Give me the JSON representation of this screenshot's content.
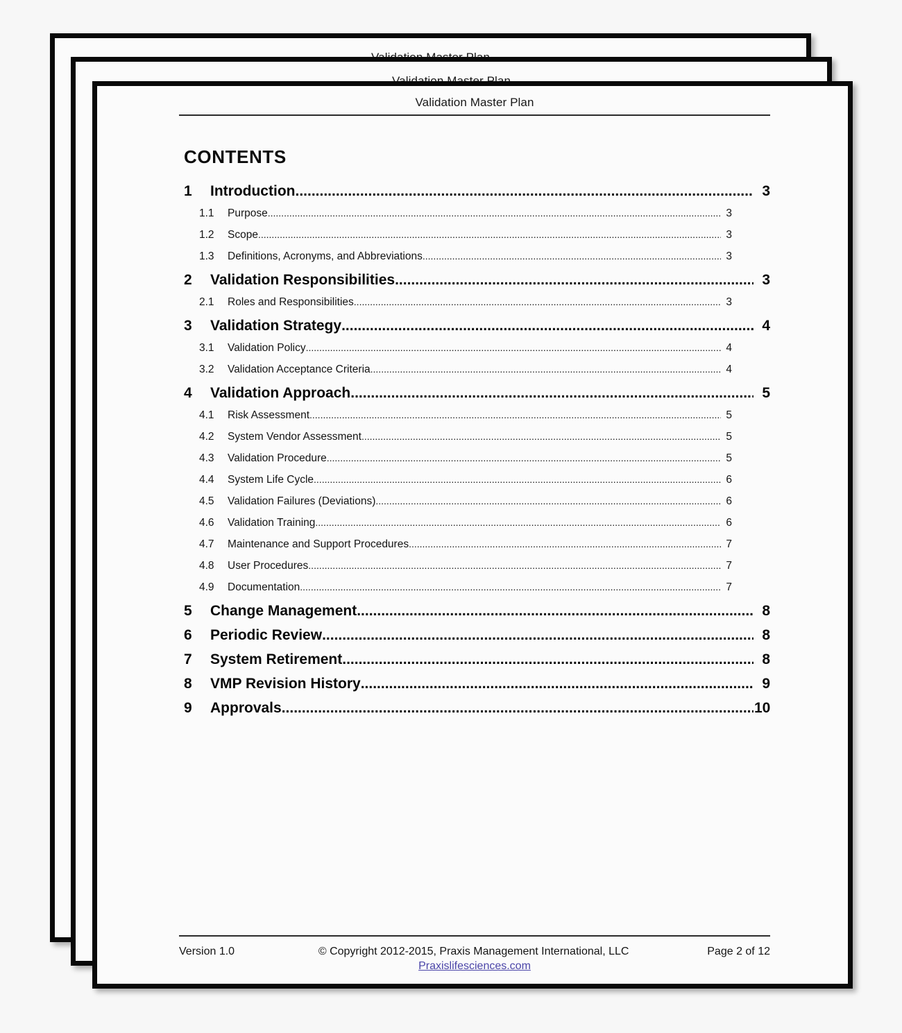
{
  "document": {
    "header_title": "Validation Master Plan",
    "contents_heading": "CONTENTS"
  },
  "stack": {
    "back_sheet_1_header": "Validation Master Plan",
    "back_sheet_2_header": "Validation Master Plan"
  },
  "toc": {
    "entries": [
      {
        "level": 1,
        "number": "1",
        "label": "Introduction",
        "page": "3"
      },
      {
        "level": 2,
        "number": "1.1",
        "label": "Purpose",
        "page": "3"
      },
      {
        "level": 2,
        "number": "1.2",
        "label": "Scope",
        "page": "3"
      },
      {
        "level": 2,
        "number": "1.3",
        "label": "Definitions, Acronyms, and Abbreviations",
        "page": "3"
      },
      {
        "level": 1,
        "number": "2",
        "label": "Validation Responsibilities",
        "page": "3"
      },
      {
        "level": 2,
        "number": "2.1",
        "label": "Roles and Responsibilities",
        "page": "3"
      },
      {
        "level": 1,
        "number": "3",
        "label": "Validation Strategy",
        "page": "4"
      },
      {
        "level": 2,
        "number": "3.1",
        "label": "Validation Policy",
        "page": "4"
      },
      {
        "level": 2,
        "number": "3.2",
        "label": "Validation Acceptance Criteria",
        "page": "4"
      },
      {
        "level": 1,
        "number": "4",
        "label": "Validation Approach",
        "page": "5"
      },
      {
        "level": 2,
        "number": "4.1",
        "label": "Risk Assessment",
        "page": "5"
      },
      {
        "level": 2,
        "number": "4.2",
        "label": "System Vendor Assessment",
        "page": "5"
      },
      {
        "level": 2,
        "number": "4.3",
        "label": "Validation Procedure",
        "page": "5"
      },
      {
        "level": 2,
        "number": "4.4",
        "label": "System Life Cycle",
        "page": "6"
      },
      {
        "level": 2,
        "number": "4.5",
        "label": "Validation Failures (Deviations)",
        "page": "6"
      },
      {
        "level": 2,
        "number": "4.6",
        "label": "Validation Training",
        "page": "6"
      },
      {
        "level": 2,
        "number": "4.7",
        "label": "Maintenance and Support Procedures",
        "page": "7"
      },
      {
        "level": 2,
        "number": "4.8",
        "label": "User Procedures",
        "page": "7"
      },
      {
        "level": 2,
        "number": "4.9",
        "label": "Documentation",
        "page": "7"
      },
      {
        "level": 1,
        "number": "5",
        "label": "Change Management",
        "page": "8"
      },
      {
        "level": 1,
        "number": "6",
        "label": "Periodic Review",
        "page": "8"
      },
      {
        "level": 1,
        "number": "7",
        "label": "System Retirement",
        "page": "8"
      },
      {
        "level": 1,
        "number": "8",
        "label": "VMP Revision History",
        "page": "9"
      },
      {
        "level": 1,
        "number": "9",
        "label": "Approvals",
        "page": "10"
      }
    ]
  },
  "footer": {
    "version": "Version 1.0",
    "copyright": "© Copyright 2012-2015, Praxis Management International, LLC",
    "page_indicator": "Page 2 of 12",
    "link_text": "Praxislifesciences.com",
    "link_color": "#4a44a8"
  }
}
